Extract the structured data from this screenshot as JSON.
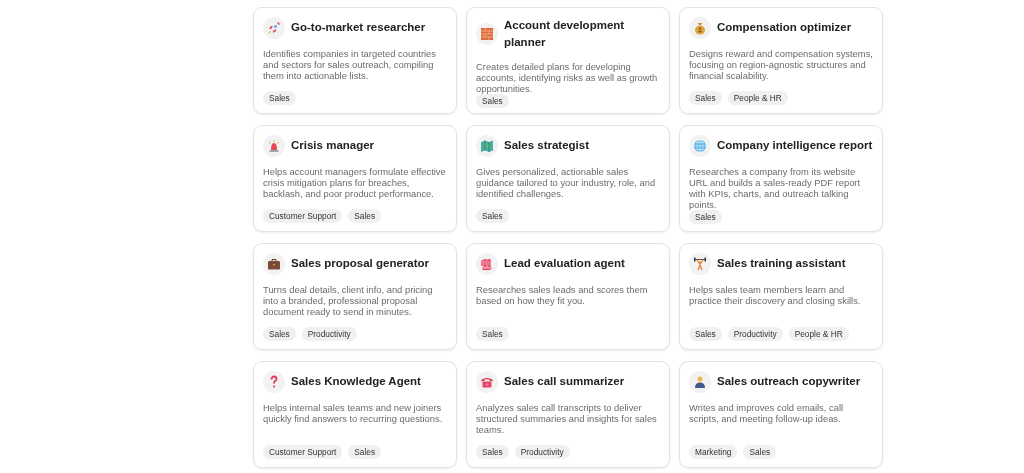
{
  "agents": [
    {
      "title": "Go-to-market researcher",
      "description": "Identifies companies in targeted countries and sectors for sales outreach, compiling them into actionable lists.",
      "tags": [
        "Sales"
      ]
    },
    {
      "title": "Account development planner",
      "description": "Creates detailed plans for developing accounts, identifying risks as well as growth opportunities.",
      "tags": [
        "Sales"
      ]
    },
    {
      "title": "Compensation optimizer",
      "description": "Designs reward and compensation systems, focusing on region-agnostic structures and financial scalability.",
      "tags": [
        "Sales",
        "People & HR"
      ]
    },
    {
      "title": "Crisis manager",
      "description": "Helps account managers formulate effective crisis mitigation plans for breaches, backlash, and poor product performance.",
      "tags": [
        "Customer Support",
        "Sales"
      ]
    },
    {
      "title": "Sales strategist",
      "description": "Gives personalized, actionable sales guidance tailored to your industry, role, and identified challenges.",
      "tags": [
        "Sales"
      ]
    },
    {
      "title": "Company intelligence report",
      "description": "Researches a company from its website URL and builds a sales-ready PDF report with KPIs, charts, and outreach talking points.",
      "tags": [
        "Sales"
      ]
    },
    {
      "title": "Sales proposal generator",
      "description": "Turns deal details, client info, and pricing into a branded, professional proposal document ready to send in minutes.",
      "tags": [
        "Sales",
        "Productivity"
      ]
    },
    {
      "title": "Lead evaluation agent",
      "description": "Researches sales leads and scores them based on how they fit you.",
      "tags": [
        "Sales"
      ]
    },
    {
      "title": "Sales training assistant",
      "description": "Helps sales team members learn and practice their discovery and closing skills.",
      "tags": [
        "Sales",
        "Productivity",
        "People & HR"
      ]
    },
    {
      "title": "Sales Knowledge Agent",
      "description": "Helps internal sales teams and new joiners quickly find answers to recurring questions.",
      "tags": [
        "Customer Support",
        "Sales"
      ]
    },
    {
      "title": "Sales call summarizer",
      "description": "Analyzes sales call transcripts to deliver structured summaries and insights for sales teams.",
      "tags": [
        "Sales",
        "Productivity"
      ]
    },
    {
      "title": "Sales outreach copywriter",
      "description": "Writes and improves cold emails, call scripts, and meeting follow-up ideas.",
      "tags": [
        "Marketing",
        "Sales"
      ]
    }
  ]
}
